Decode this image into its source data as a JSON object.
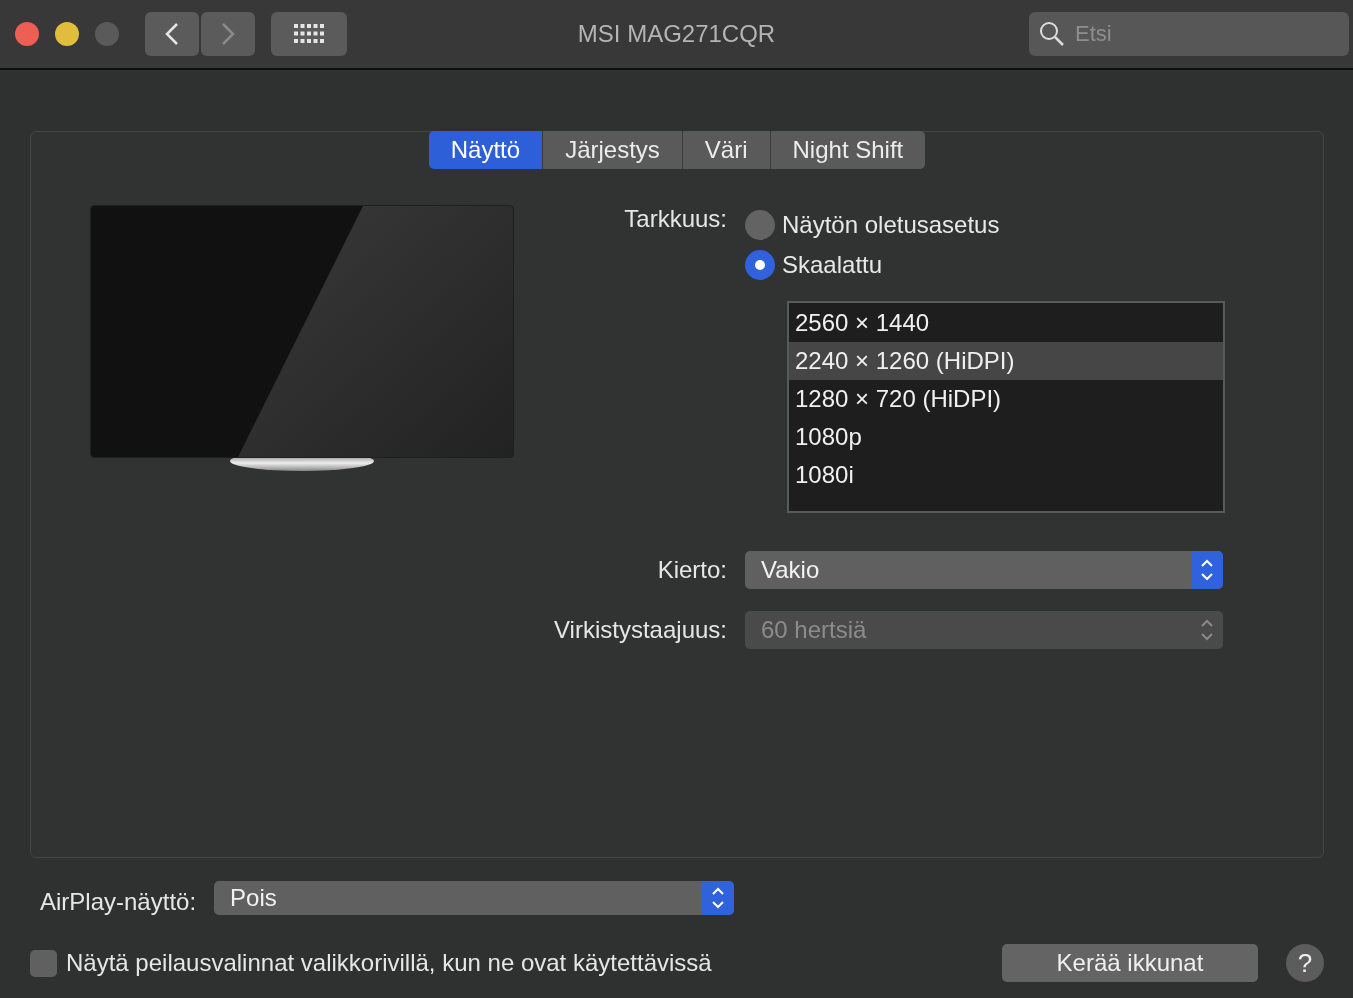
{
  "window": {
    "title": "MSI MAG271CQR"
  },
  "search": {
    "placeholder": "Etsi"
  },
  "tabs": [
    {
      "label": "Näyttö",
      "selected": true
    },
    {
      "label": "Järjestys",
      "selected": false
    },
    {
      "label": "Väri",
      "selected": false
    },
    {
      "label": "Night Shift",
      "selected": false
    }
  ],
  "resolution": {
    "label": "Tarkkuus:",
    "options": [
      {
        "label": "Näytön oletusasetus",
        "selected": false
      },
      {
        "label": "Skaalattu",
        "selected": true
      }
    ],
    "list": [
      {
        "label": "2560 × 1440",
        "selected": false
      },
      {
        "label": "2240 × 1260 (HiDPI)",
        "selected": true
      },
      {
        "label": "1280 × 720 (HiDPI)",
        "selected": false
      },
      {
        "label": "1080p",
        "selected": false
      },
      {
        "label": "1080i",
        "selected": false
      }
    ]
  },
  "settings": [
    {
      "label": "Kierto:",
      "value": "Vakio",
      "disabled": false
    },
    {
      "label": "Virkistystaajuus:",
      "value": "60 hertsiä",
      "disabled": true
    }
  ],
  "airplay": {
    "label": "AirPlay-näyttö:",
    "value": "Pois",
    "disabled": false
  },
  "mirror_option": {
    "label": "Näytä peilausvalinnat valikkorivillä, kun ne ovat käytettävissä",
    "checked": false
  },
  "gather_button": "Kerää ikkunat",
  "help_button": "?"
}
